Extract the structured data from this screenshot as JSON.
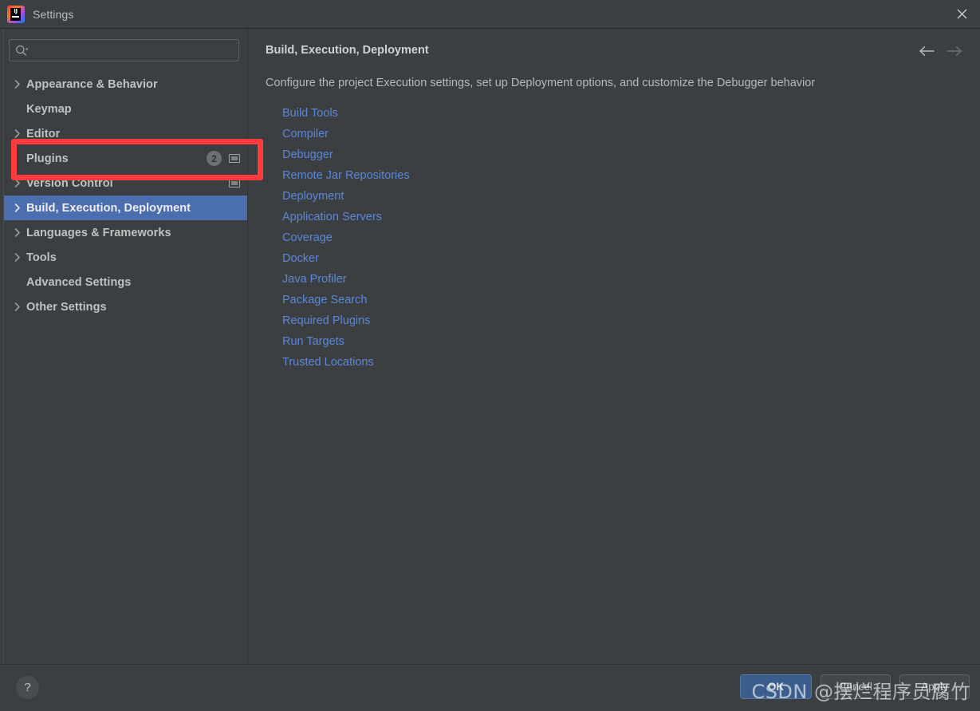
{
  "window": {
    "title": "Settings",
    "app_icon": "intellij-idea-logo",
    "close_icon": "close-icon"
  },
  "sidebar": {
    "search": {
      "placeholder": "",
      "value": "",
      "icon": "search-icon"
    },
    "items": [
      {
        "label": "Appearance & Behavior",
        "expandable": true,
        "selected": false,
        "badge": null,
        "trailing_icon": null
      },
      {
        "label": "Keymap",
        "expandable": false,
        "selected": false,
        "badge": null,
        "trailing_icon": null
      },
      {
        "label": "Editor",
        "expandable": true,
        "selected": false,
        "badge": null,
        "trailing_icon": null
      },
      {
        "label": "Plugins",
        "expandable": false,
        "selected": false,
        "badge": "2",
        "trailing_icon": "monitor-icon"
      },
      {
        "label": "Version Control",
        "expandable": true,
        "selected": false,
        "badge": null,
        "trailing_icon": "monitor-icon"
      },
      {
        "label": "Build, Execution, Deployment",
        "expandable": true,
        "selected": true,
        "badge": null,
        "trailing_icon": null
      },
      {
        "label": "Languages & Frameworks",
        "expandable": true,
        "selected": false,
        "badge": null,
        "trailing_icon": null
      },
      {
        "label": "Tools",
        "expandable": true,
        "selected": false,
        "badge": null,
        "trailing_icon": null
      },
      {
        "label": "Advanced Settings",
        "expandable": false,
        "selected": false,
        "badge": null,
        "trailing_icon": null
      },
      {
        "label": "Other Settings",
        "expandable": true,
        "selected": false,
        "badge": null,
        "trailing_icon": null
      }
    ]
  },
  "annotation": {
    "color": "#FF3B3B",
    "target": "Plugins"
  },
  "content": {
    "title": "Build, Execution, Deployment",
    "description": "Configure the project Execution settings, set up Deployment options, and customize the Debugger behavior",
    "links": [
      "Build Tools",
      "Compiler",
      "Debugger",
      "Remote Jar Repositories",
      "Deployment",
      "Application Servers",
      "Coverage",
      "Docker",
      "Java Profiler",
      "Package Search",
      "Required Plugins",
      "Run Targets",
      "Trusted Locations"
    ],
    "nav": {
      "back_icon": "arrow-left-icon",
      "forward_icon": "arrow-right-icon"
    }
  },
  "footer": {
    "help_label": "?",
    "ok_label": "OK",
    "cancel_label": "Cancel",
    "apply_label": "Apply"
  },
  "watermark": {
    "text": "CSDN @摆烂程序员腐竹"
  },
  "colors": {
    "window_bg": "#3C3F41",
    "selection_blue": "#4B6EAF",
    "link_blue": "#5C87D6",
    "annotation_red": "#FF3B3B",
    "primary_button": "#3A5D8C"
  }
}
